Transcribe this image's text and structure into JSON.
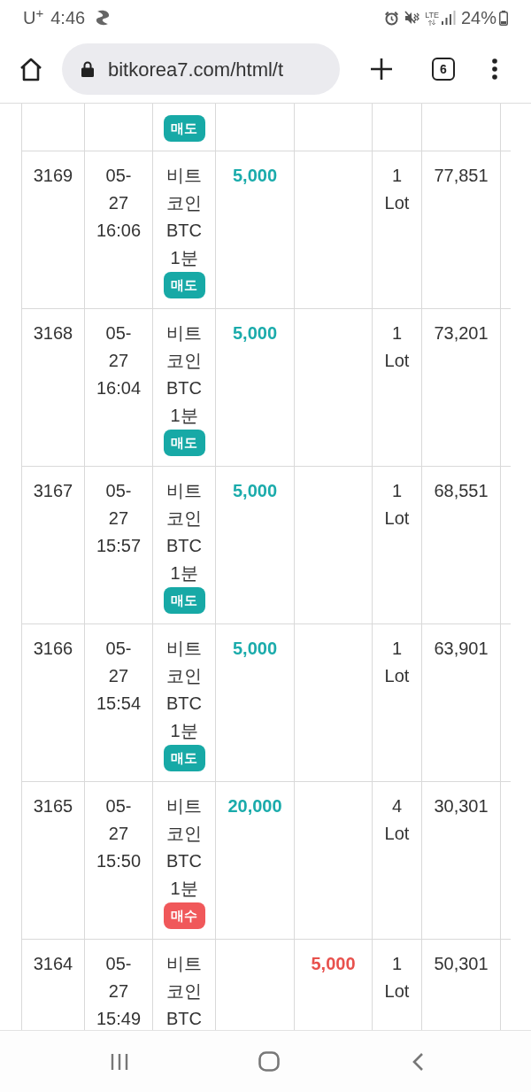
{
  "status_bar": {
    "carrier": "U$^{+}$",
    "time": "4:46",
    "network": "LTE",
    "battery": "24%"
  },
  "browser_toolbar": {
    "url": "bitkorea7.com/html/t",
    "tab_count": "6"
  },
  "table": {
    "rows": [
      {
        "kind": "partial",
        "side": {
          "label": "매도",
          "kind": "sell"
        }
      },
      {
        "kind": "full",
        "number": "3169",
        "datetime": "05-27 16:06",
        "product": "비트코인 BTC 1분",
        "buy_amount": "5,000",
        "lots": "1 Lot",
        "price": "77,851",
        "side": {
          "label": "매도",
          "kind": "sell"
        }
      },
      {
        "kind": "full",
        "number": "3168",
        "datetime": "05-27 16:04",
        "product": "비트코인 BTC 1분",
        "buy_amount": "5,000",
        "lots": "1 Lot",
        "price": "73,201",
        "side": {
          "label": "매도",
          "kind": "sell"
        }
      },
      {
        "kind": "full",
        "number": "3167",
        "datetime": "05-27 15:57",
        "product": "비트코인 BTC 1분",
        "buy_amount": "5,000",
        "lots": "1 Lot",
        "price": "68,551",
        "side": {
          "label": "매도",
          "kind": "sell"
        }
      },
      {
        "kind": "full",
        "number": "3166",
        "datetime": "05-27 15:54",
        "product": "비트코인 BTC 1분",
        "buy_amount": "5,000",
        "lots": "1 Lot",
        "price": "63,901",
        "side": {
          "label": "매도",
          "kind": "sell"
        }
      },
      {
        "kind": "full",
        "number": "3165",
        "datetime": "05-27 15:50",
        "product": "비트코인 BTC 1분",
        "buy_amount": "20,000",
        "lots": "4 Lot",
        "price": "30,301",
        "side": {
          "label": "매수",
          "kind": "buy"
        }
      },
      {
        "kind": "full",
        "number": "3164",
        "datetime": "05-27 15:49",
        "product": "비트코인 BTC",
        "sell_amount": "5,000",
        "lots": "1 Lot",
        "price": "50,301"
      }
    ]
  }
}
